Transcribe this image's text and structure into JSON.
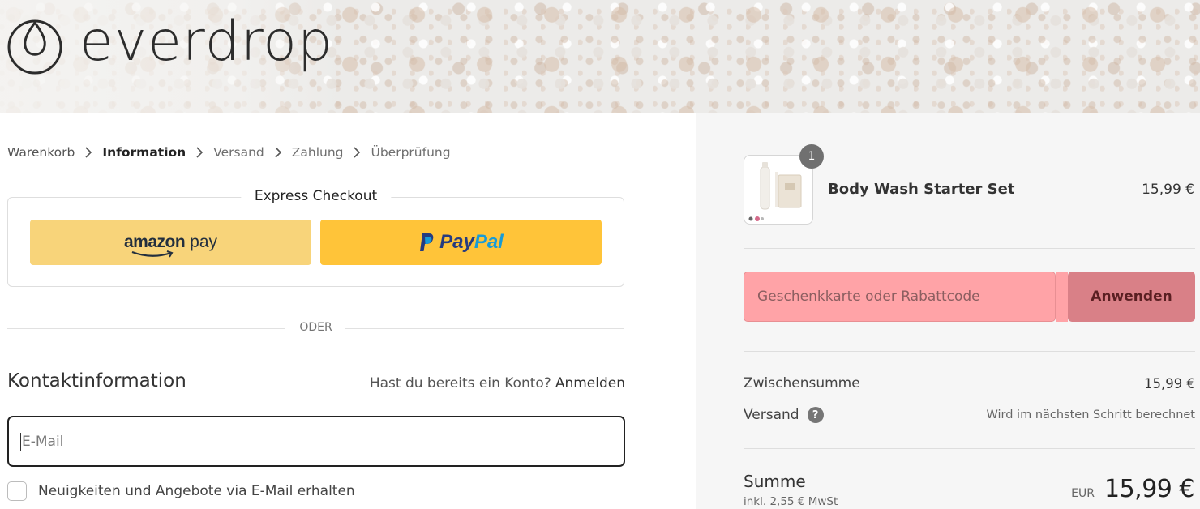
{
  "brand": {
    "name": "everdrop"
  },
  "breadcrumb": {
    "items": [
      "Warenkorb",
      "Information",
      "Versand",
      "Zahlung",
      "Überprüfung"
    ],
    "current_index": 1
  },
  "express_checkout": {
    "title": "Express Checkout",
    "amazon_pay": {
      "word": "amazon",
      "suffix": "pay",
      "color": "#f8d47a"
    },
    "paypal": {
      "pay": "Pay",
      "pal": "Pal",
      "color": "#ffc439"
    }
  },
  "separator_text": "ODER",
  "contact": {
    "title": "Kontaktinformation",
    "login_prompt": "Hast du bereits ein Konto?",
    "login_link": "Anmelden",
    "email_placeholder": "E-Mail",
    "email_value": "",
    "newsletter_label": "Neuigkeiten und Angebote via E-Mail erhalten",
    "newsletter_checked": false
  },
  "order_summary": {
    "item": {
      "name": "Body Wash Starter Set",
      "price": "15,99 €",
      "quantity": "1"
    },
    "discount": {
      "placeholder": "Geschenkkarte oder Rabattcode",
      "value": "",
      "apply_label": "Anwenden"
    },
    "subtotal_label": "Zwischensumme",
    "subtotal_value": "15,99 €",
    "shipping_label": "Versand",
    "shipping_help": "?",
    "shipping_value": "Wird im nächsten Schritt berechnet",
    "total_label": "Summe",
    "tax_note": "inkl. 2,55 € MwSt",
    "currency": "EUR",
    "total_value": "15,99 €"
  },
  "colors": {
    "accent_discount_field": "#ffa3a7",
    "accent_discount_button": "#d98087",
    "amazon_yellow": "#f8d47a",
    "paypal_yellow": "#ffc439"
  }
}
